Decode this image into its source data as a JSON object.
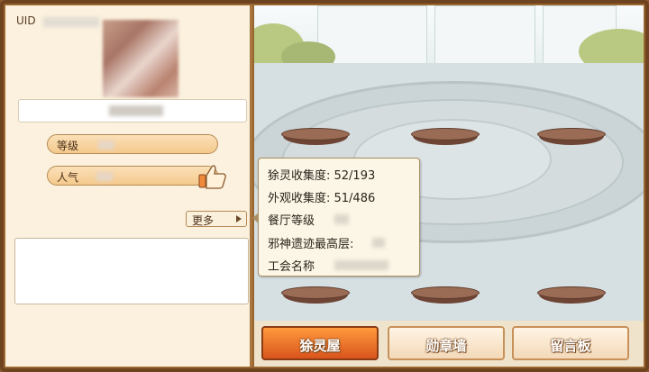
{
  "profile": {
    "uid_label": "UID",
    "level_label": "等级",
    "popularity_label": "人气",
    "more_label": "更多"
  },
  "tooltip": {
    "rows": [
      "狳灵收集度: 52/193",
      "外观收集度: 51/486",
      "餐厅等级",
      "邪神遗迹最高层:",
      "工会名称"
    ]
  },
  "tabs": [
    {
      "label": "狳灵屋",
      "active": true
    },
    {
      "label": "勋章墙",
      "active": false
    },
    {
      "label": "留言板",
      "active": false
    }
  ],
  "colors": {
    "active_tab": "#d9541c",
    "panel_bg": "#fbf1de",
    "frame": "#9a6630"
  }
}
